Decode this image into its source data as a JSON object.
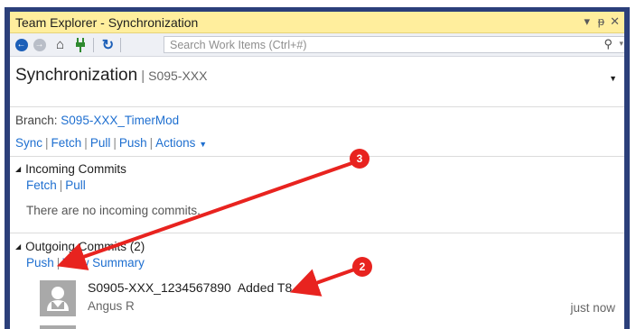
{
  "window": {
    "title": "Team Explorer - Synchronization",
    "controls": [
      "▾",
      "ᵽ",
      "✕"
    ]
  },
  "toolbar": {
    "search_placeholder": "Search Work Items (Ctrl+#)",
    "icons": [
      "back-arrow-icon",
      "forward-arrow-icon",
      "home-icon",
      "connect-plug-icon",
      "refresh-icon",
      "search-icon"
    ]
  },
  "header": {
    "title": "Synchronization",
    "separator": "|",
    "context": "S095-XXX"
  },
  "branch": {
    "label": "Branch:",
    "name": "S095-XXX_TimerMod"
  },
  "actions": {
    "sync": "Sync",
    "fetch": "Fetch",
    "pull": "Pull",
    "push": "Push",
    "actions": "Actions"
  },
  "incoming": {
    "title": "Incoming Commits",
    "fetch": "Fetch",
    "pull": "Pull",
    "message": "There are no incoming commits."
  },
  "outgoing": {
    "title": "Outgoing Commits (2)",
    "push": "Push",
    "view_summary": "View Summary",
    "commits": [
      {
        "message": "S0905-XXX_1234567890  Added T8",
        "author": "Angus R",
        "time": "just now"
      }
    ]
  },
  "annotations": [
    {
      "label": "3",
      "color": "#e8231f"
    },
    {
      "label": "2",
      "color": "#e8231f"
    }
  ],
  "colors": {
    "frame": "#2b3f7a",
    "titlebar": "#ffee9d",
    "link": "#1e6fd0",
    "annotation": "#e8231f"
  }
}
